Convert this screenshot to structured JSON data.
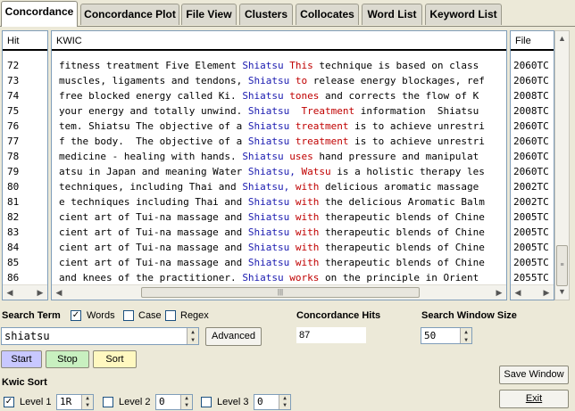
{
  "tabs": [
    {
      "label": "Concordance",
      "active": true
    },
    {
      "label": "Concordance Plot"
    },
    {
      "label": "File View"
    },
    {
      "label": "Clusters"
    },
    {
      "label": "Collocates"
    },
    {
      "label": "Word List"
    },
    {
      "label": "Keyword List"
    }
  ],
  "table": {
    "headers": {
      "hit": "Hit",
      "kwic": "KWIC",
      "file": "File"
    },
    "rows": [
      {
        "hit": "72",
        "left": "fitness treatment Five Element ",
        "key": "Shiatsu",
        "right_colored": " This",
        "right_rest": " technique is based on class",
        "file": "2060TC"
      },
      {
        "hit": "73",
        "left": "muscles, ligaments and tendons, ",
        "key": "Shiatsu",
        "right_colored": " to",
        "right_rest": " release energy blockages, ref",
        "file": "2060TC"
      },
      {
        "hit": "74",
        "left": "free blocked energy called Ki. ",
        "key": "Shiatsu",
        "right_colored": " tones",
        "right_rest": " and corrects the flow of K",
        "file": "2008TC"
      },
      {
        "hit": "75",
        "left": "your energy and totally unwind. ",
        "key": "Shiatsu",
        "right_colored": "  Treatment",
        "right_rest": " information  Shiatsu ",
        "file": "2008TC"
      },
      {
        "hit": "76",
        "left": "tem. Shiatsu The objective of a ",
        "key": "Shiatsu",
        "right_colored": " treatment",
        "right_rest": " is to achieve unrestri",
        "file": "2060TC"
      },
      {
        "hit": "77",
        "left": "f the body.  The objective of a ",
        "key": "Shiatsu",
        "right_colored": " treatment",
        "right_rest": " is to achieve unrestri",
        "file": "2060TC"
      },
      {
        "hit": "78",
        "left": "medicine - healing with hands. ",
        "key": "Shiatsu",
        "right_colored": " uses",
        "right_rest": " hand pressure and manipulat",
        "file": "2060TC"
      },
      {
        "hit": "79",
        "left": "atsu in Japan and meaning Water ",
        "key": "Shiatsu,",
        "right_colored": " Watsu",
        "right_rest": " is a holistic therapy les",
        "file": "2060TC"
      },
      {
        "hit": "80",
        "left": "techniques, including Thai and ",
        "key": "Shiatsu,",
        "right_colored": " with",
        "right_rest": " delicious aromatic massage",
        "file": "2002TC"
      },
      {
        "hit": "81",
        "left": "e techniques including Thai and ",
        "key": "Shiatsu",
        "right_colored": " with",
        "right_rest": " the delicious Aromatic Balm",
        "file": "2002TC"
      },
      {
        "hit": "82",
        "left": "cient art of Tui-na massage and ",
        "key": "Shiatsu",
        "right_colored": " with",
        "right_rest": " therapeutic blends of Chine",
        "file": "2005TC"
      },
      {
        "hit": "83",
        "left": "cient art of Tui-na massage and ",
        "key": "Shiatsu",
        "right_colored": " with",
        "right_rest": " therapeutic blends of Chine",
        "file": "2005TC"
      },
      {
        "hit": "84",
        "left": "cient art of Tui-na massage and ",
        "key": "Shiatsu",
        "right_colored": " with",
        "right_rest": " therapeutic blends of Chine",
        "file": "2005TC"
      },
      {
        "hit": "85",
        "left": "cient art of Tui-na massage and ",
        "key": "Shiatsu",
        "right_colored": " with",
        "right_rest": " therapeutic blends of Chine",
        "file": "2005TC"
      },
      {
        "hit": "86",
        "left": "and knees of the practitioner. ",
        "key": "Shiatsu",
        "right_colored": " works",
        "right_rest": " on the principle in Orient",
        "file": "2055TC"
      }
    ]
  },
  "search": {
    "term_label": "Search Term",
    "words_label": "Words",
    "words_checked": true,
    "case_label": "Case",
    "case_checked": false,
    "regex_label": "Regex",
    "regex_checked": false,
    "value": "shiatsu",
    "advanced_label": "Advanced",
    "start_label": "Start",
    "stop_label": "Stop",
    "sort_label": "Sort"
  },
  "hits": {
    "label": "Concordance Hits",
    "value": "87"
  },
  "window": {
    "label": "Search Window Size",
    "value": "50"
  },
  "kwic_sort": {
    "label": "Kwic Sort",
    "level1": {
      "label": "Level 1",
      "checked": true,
      "value": "1R"
    },
    "level2": {
      "label": "Level 2",
      "checked": false,
      "value": "0"
    },
    "level3": {
      "label": "Level 3",
      "checked": false,
      "value": "0"
    }
  },
  "actions": {
    "save_label": "Save Window",
    "exit_label": "Exit"
  },
  "colors": {
    "keyword": "#1a1ab0",
    "collocate": "#c00000",
    "start_btn": "#c8c8ff",
    "stop_btn": "#c8f0c0",
    "sort_btn": "#fff8c0"
  }
}
